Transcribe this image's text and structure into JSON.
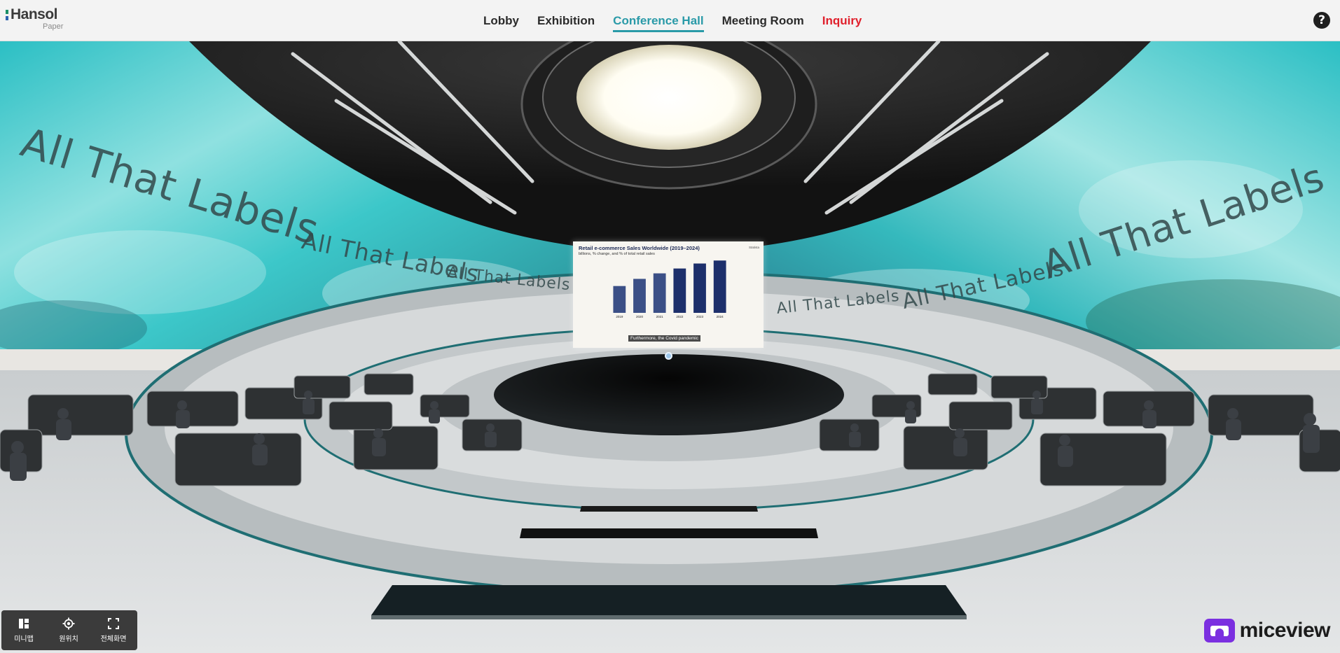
{
  "brand": {
    "name": "Hansol",
    "sub": "Paper"
  },
  "nav": {
    "items": [
      {
        "label": "Lobby"
      },
      {
        "label": "Exhibition"
      },
      {
        "label": "Conference Hall"
      },
      {
        "label": "Meeting Room"
      },
      {
        "label": "Inquiry"
      }
    ],
    "active": "Conference Hall"
  },
  "help": {
    "label": "?"
  },
  "scene": {
    "wall_text": "All That Labels",
    "slide": {
      "title": "Retail e-commerce Sales Worldwide (2019–2024)",
      "subtitle": "billions, % change, and % of total retail sales",
      "source": "Statista",
      "caption": "Furthermore, the Covid pandemic"
    }
  },
  "controls": [
    {
      "label": "미니맵",
      "icon": "minimap-icon"
    },
    {
      "label": "원위치",
      "icon": "reset-position-icon"
    },
    {
      "label": "전체화면",
      "icon": "fullscreen-icon"
    }
  ],
  "logo": {
    "text": "miceview"
  },
  "colors": {
    "accent": "#2a9aa8",
    "inquiry": "#e0202c",
    "logo": "#7b2fe0"
  },
  "chart_data": {
    "type": "bar",
    "categories": [
      "2019",
      "2020",
      "2021",
      "2022",
      "2023",
      "2024"
    ],
    "values": [
      3.354,
      4.248,
      4.938,
      5.545,
      6.169,
      6.542
    ],
    "ylim": [
      0,
      7
    ]
  }
}
